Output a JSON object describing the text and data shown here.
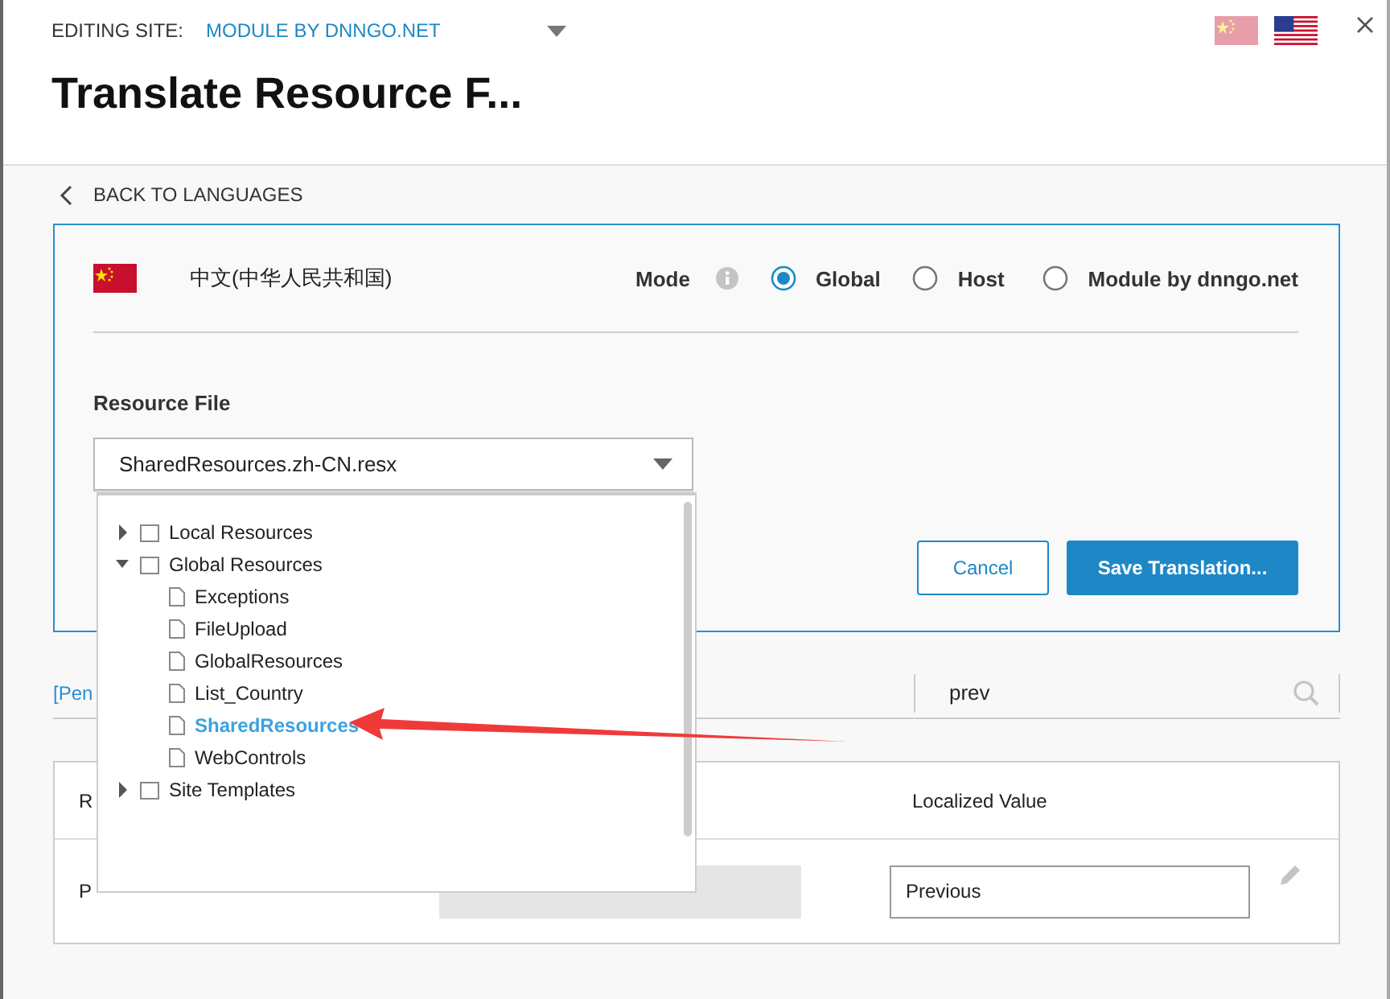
{
  "header": {
    "label": "EDITING SITE:",
    "site": "MODULE BY DNNGO.NET",
    "title": "Translate Resource F...",
    "flags": [
      {
        "kind": "china",
        "selected": false
      },
      {
        "kind": "usa",
        "selected": true
      }
    ]
  },
  "back_link": "BACK TO LANGUAGES",
  "language": {
    "name": "中文(中华人民共和国)"
  },
  "mode": {
    "label": "Mode",
    "options": [
      {
        "label": "Global",
        "selected": true
      },
      {
        "label": "Host",
        "selected": false
      },
      {
        "label": "Module by dnngo.net",
        "selected": false
      }
    ]
  },
  "resource_file": {
    "label": "Resource File",
    "value": "SharedResources.zh-CN.resx",
    "expanded": true
  },
  "tree": [
    {
      "label": "Local Resources",
      "kind": "folder",
      "expanded": false,
      "selected": false
    },
    {
      "label": "Global Resources",
      "kind": "folder",
      "expanded": true,
      "selected": false,
      "children": [
        {
          "label": "Exceptions",
          "kind": "file",
          "selected": false
        },
        {
          "label": "FileUpload",
          "kind": "file",
          "selected": false
        },
        {
          "label": "GlobalResources",
          "kind": "file",
          "selected": false
        },
        {
          "label": "List_Country",
          "kind": "file",
          "selected": false
        },
        {
          "label": "SharedResources",
          "kind": "file",
          "selected": true
        },
        {
          "label": "WebControls",
          "kind": "file",
          "selected": false
        }
      ]
    },
    {
      "label": "Site Templates",
      "kind": "folder",
      "expanded": false,
      "selected": false
    }
  ],
  "buttons": [
    {
      "label": "Cancel",
      "kind": "secondary"
    },
    {
      "label": "Save Translation...",
      "kind": "primary"
    }
  ],
  "filter": {
    "link": "[Pen",
    "search_value": "prev"
  },
  "table": {
    "columns": [
      "R",
      "Localized Value"
    ],
    "rows": [
      {
        "cells": [
          "P"
        ],
        "localized_value": "Previous"
      }
    ]
  }
}
